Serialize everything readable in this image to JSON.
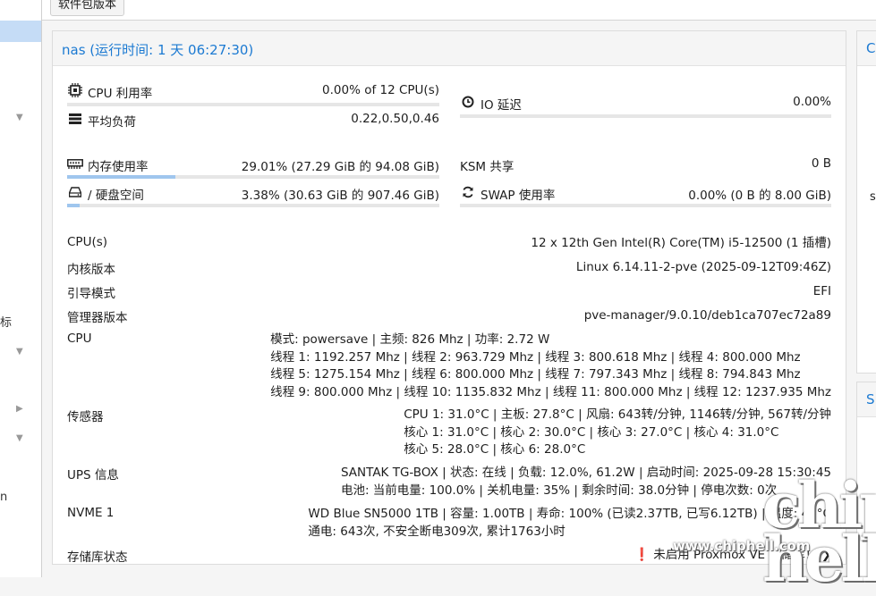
{
  "toolbar": {
    "package_button": "软件包版本"
  },
  "sidebar": {
    "fragment_1": "标",
    "fragment_2": "n"
  },
  "panel": {
    "title": "nas (运行时间: 1 天 06:27:30)"
  },
  "right_panels": {
    "top_header": "C",
    "bottom_header": "S",
    "fragment": "s"
  },
  "stats": {
    "cpu": {
      "label": "CPU 利用率",
      "value": "0.00% of 12 CPU(s)",
      "percent": 0.0
    },
    "io": {
      "label": "IO 延迟",
      "value": "0.00%",
      "percent": 0.0
    },
    "load": {
      "label": "平均负荷",
      "value": "0.22,0.50,0.46"
    },
    "memory": {
      "label": "内存使用率",
      "value": "29.01% (27.29 GiB 的 94.08 GiB)",
      "percent": 29.01
    },
    "ksm": {
      "label": "KSM 共享",
      "value": "0 B"
    },
    "disk": {
      "label": "/ 硬盘空间",
      "value": "3.38% (30.63 GiB 的 907.46 GiB)",
      "percent": 3.38
    },
    "swap": {
      "label": "SWAP 使用率",
      "value": "0.00% (0 B 的 8.00 GiB)",
      "percent": 0.0
    }
  },
  "info": {
    "cpus": {
      "label": "CPU(s)",
      "value": "12 x 12th Gen Intel(R) Core(TM) i5-12500 (1 插槽)"
    },
    "kernel": {
      "label": "内核版本",
      "value": "Linux 6.14.11-2-pve (2025-09-12T09:46Z)"
    },
    "boot": {
      "label": "引导模式",
      "value": "EFI"
    },
    "manager": {
      "label": "管理器版本",
      "value": "pve-manager/9.0.10/deb1ca707ec72a89"
    },
    "cpu": {
      "label": "CPU",
      "lines": [
        "模式: powersave | 主频: 826 Mhz | 功率: 2.72 W",
        "线程 1: 1192.257 Mhz | 线程 2: 963.729 Mhz | 线程 3: 800.618 Mhz | 线程 4: 800.000 Mhz",
        "线程 5: 1275.154 Mhz | 线程 6: 800.000 Mhz | 线程 7: 797.343 Mhz | 线程 8: 794.843 Mhz",
        "线程 9: 800.000 Mhz | 线程 10: 1135.832 Mhz | 线程 11: 800.000 Mhz | 线程 12: 1237.935 Mhz"
      ]
    },
    "sensors": {
      "label": "传感器",
      "lines": [
        "CPU 1: 31.0°C | 主板: 27.8°C | 风扇: 643转/分钟, 1146转/分钟, 567转/分钟",
        "核心 1: 31.0°C | 核心 2: 30.0°C | 核心 3: 27.0°C | 核心 4: 31.0°C",
        "核心 5: 28.0°C | 核心 6: 28.0°C"
      ]
    },
    "ups": {
      "label": "UPS 信息",
      "lines": [
        "SANTAK TG-BOX | 状态: 在线 | 负载: 12.0%, 61.2W | 启动时间: 2025-09-28 15:30:45",
        "电池: 当前电量: 100.0% | 关机电量: 35% | 剩余时间: 38.0分钟 | 停电次数: 0次"
      ]
    },
    "nvme": {
      "label": "NVME 1",
      "lines": [
        "WD Blue SN5000 1TB | 容量: 1.00TB | 寿命: 100% (已读2.37TB, 已写6.12TB) | 温度: 41°C",
        "通电: 643次, 不安全断电309次, 累计1763小时"
      ]
    },
    "repo": {
      "label": "存储库状态",
      "value": "未启用 Proxmox VE 存储库！"
    }
  },
  "watermark": {
    "site": "www.chiphell.com",
    "logo": "chip hell"
  }
}
